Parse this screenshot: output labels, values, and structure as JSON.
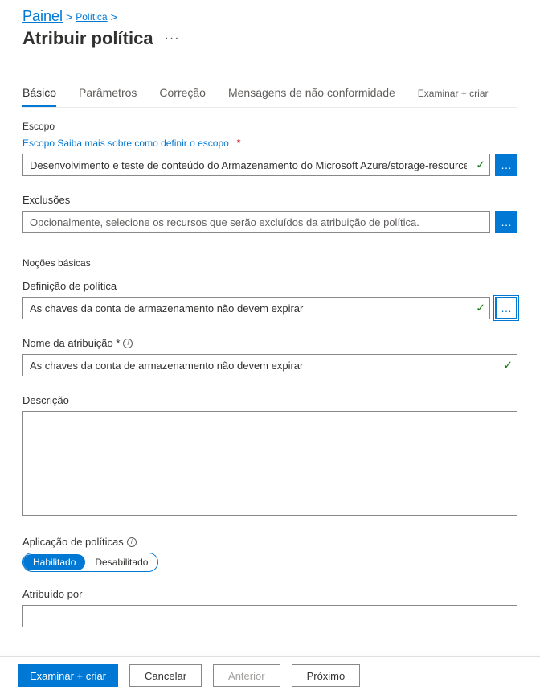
{
  "breadcrumb": {
    "home": "Painel",
    "items": [
      "Política"
    ]
  },
  "page_title": "Atribuir política",
  "tabs": [
    {
      "label": "Básico",
      "active": true
    },
    {
      "label": "Parâmetros",
      "active": false
    },
    {
      "label": "Correção",
      "active": false
    },
    {
      "label": "Mensagens de não conformidade",
      "active": false
    },
    {
      "label": "Examinar + criar",
      "active": false
    }
  ],
  "scope": {
    "heading": "Escopo",
    "link_text": "Escopo Saiba mais sobre como definir o escopo",
    "value": "Desenvolvimento e teste de conteúdo do Armazenamento do Microsoft Azure/storage-resource-group-create",
    "required": true
  },
  "exclusions": {
    "label": "Exclusões",
    "placeholder": "Opcionalmente, selecione os recursos que serão excluídos da atribuição de política."
  },
  "basics": {
    "heading": "Noções básicas",
    "policy_def_label": "Definição de política",
    "policy_def_value": "As chaves da conta de armazenamento não devem expirar",
    "assignment_name_label": "Nome da atribuição *",
    "assignment_name_value": "As chaves da conta de armazenamento não devem expirar",
    "description_label": "Descrição",
    "description_value": ""
  },
  "enforcement": {
    "label": "Aplicação de políticas",
    "enabled": "Habilitado",
    "disabled": "Desabilitado"
  },
  "assigned_by": {
    "label": "Atribuído por",
    "value": ""
  },
  "footer": {
    "review_create": "Examinar + criar",
    "cancel": "Cancelar",
    "previous": "Anterior",
    "next": "Próximo"
  }
}
